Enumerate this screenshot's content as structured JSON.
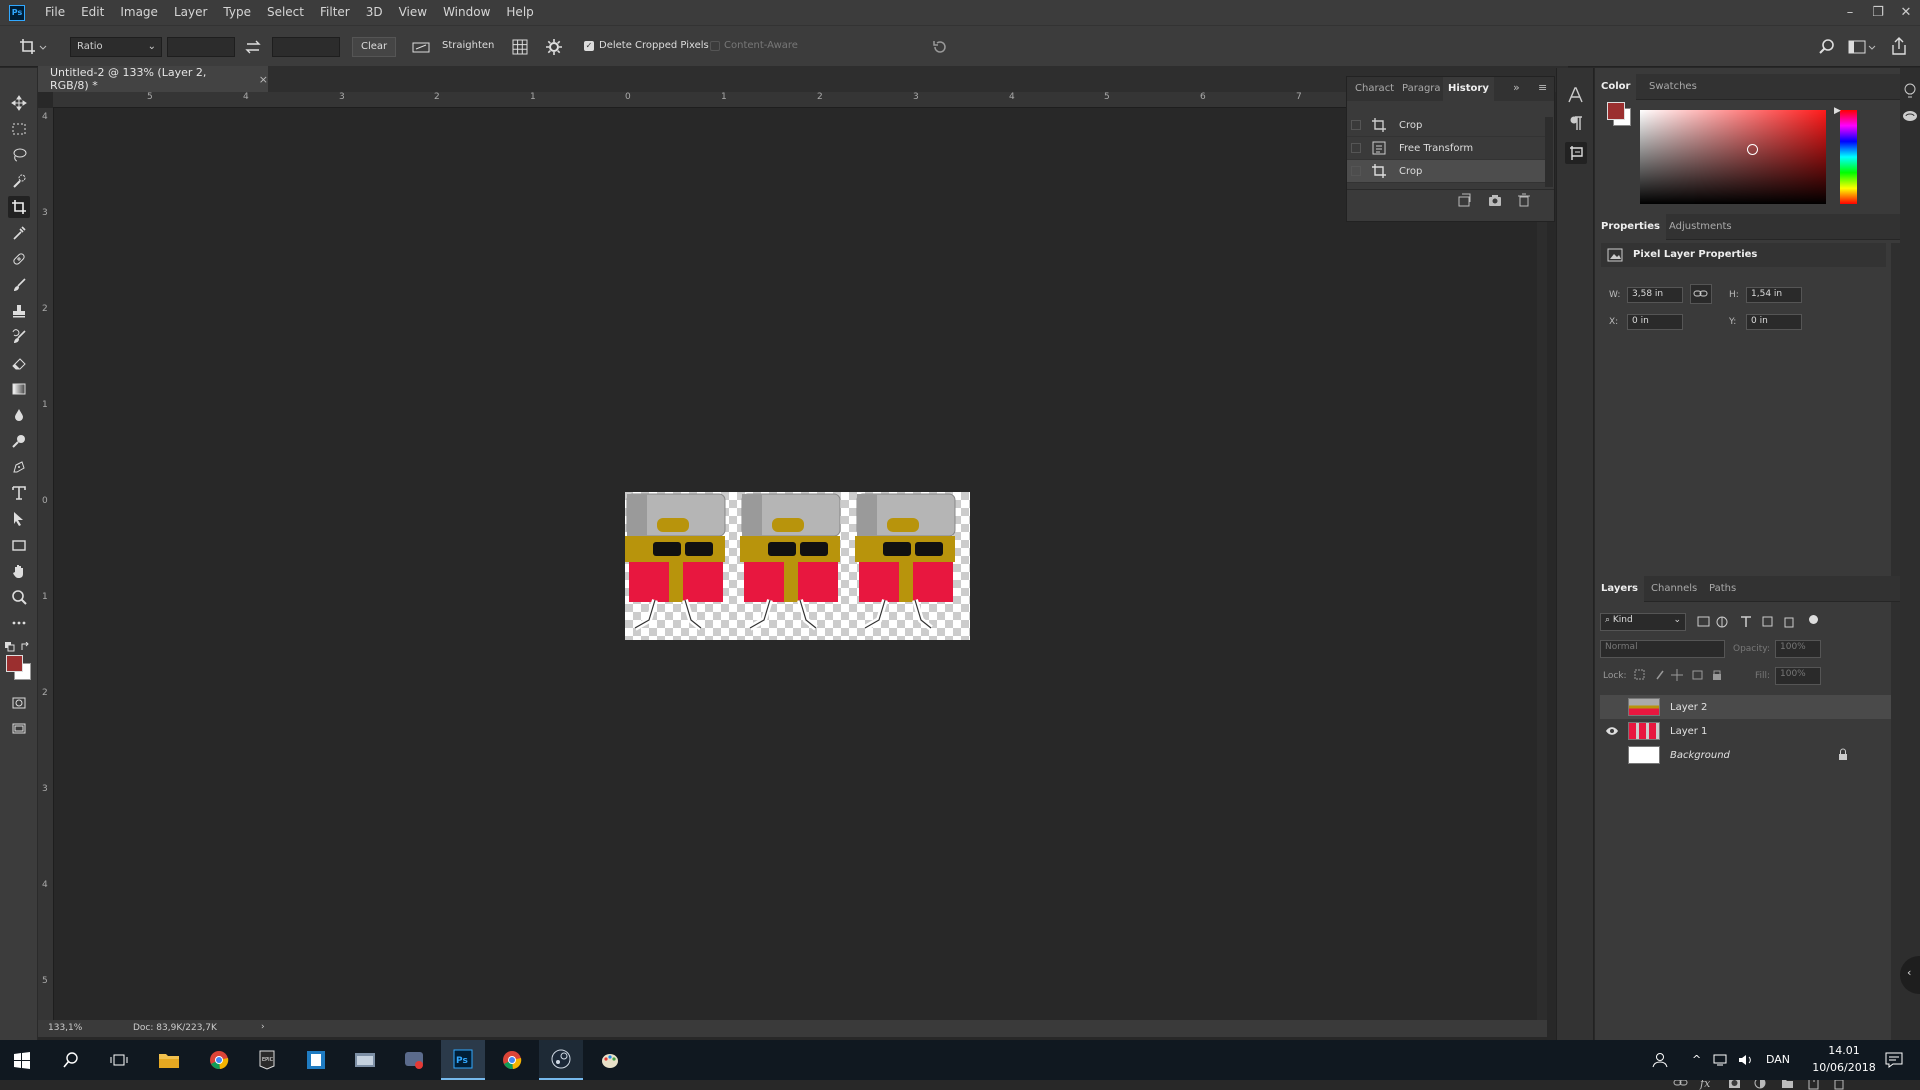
{
  "app": {
    "logo": "Ps"
  },
  "menu": [
    "File",
    "Edit",
    "Image",
    "Layer",
    "Type",
    "Select",
    "Filter",
    "3D",
    "View",
    "Window",
    "Help"
  ],
  "options": {
    "ratio_value": "Ratio",
    "clear_label": "Clear",
    "straighten_label": "Straighten",
    "delete_cropped_label": "Delete Cropped Pixels",
    "delete_cropped_checked": true,
    "content_aware_label": "Content-Aware"
  },
  "document": {
    "tab_title": "Untitled-2 @ 133% (Layer 2, RGB/8) *",
    "close": "×"
  },
  "rulers": {
    "h": [
      "5",
      "4",
      "3",
      "2",
      "1",
      "0",
      "1",
      "2",
      "3",
      "4",
      "5",
      "6",
      "7"
    ],
    "v": [
      "4",
      "3",
      "2",
      "1",
      "0",
      "1",
      "2",
      "3",
      "4",
      "5"
    ]
  },
  "status": {
    "zoom": "133,1%",
    "doc": "Doc: 83,9K/223,7K"
  },
  "history": {
    "tabs": [
      "Charact",
      "Paragra",
      "History"
    ],
    "items": [
      {
        "label": "Crop",
        "icon": "crop-icon"
      },
      {
        "label": "Free Transform",
        "icon": "transform-icon"
      },
      {
        "label": "Crop",
        "icon": "crop-icon",
        "selected": true
      }
    ]
  },
  "color_panel": {
    "tabs": [
      "Color",
      "Swatches"
    ],
    "foreground": "#9b2f2f",
    "background": "#ffffff"
  },
  "properties": {
    "tabs": [
      "Properties",
      "Adjustments"
    ],
    "title": "Pixel Layer Properties",
    "w_label": "W:",
    "w": "3,58 in",
    "h_label": "H:",
    "h": "1,54 in",
    "x_label": "X:",
    "x": "0 in",
    "y_label": "Y:",
    "y": "0 in"
  },
  "layers": {
    "tabs": [
      "Layers",
      "Channels",
      "Paths"
    ],
    "filter": "Kind",
    "blend": "Normal",
    "opacity_label": "Opacity:",
    "opacity": "100%",
    "lock_label": "Lock:",
    "fill_label": "Fill:",
    "fill": "100%",
    "items": [
      {
        "name": "Layer 2",
        "visible": false,
        "selected": true
      },
      {
        "name": "Layer 1",
        "visible": true,
        "selected": false
      },
      {
        "name": "Background",
        "visible": false,
        "locked": true,
        "italic": true
      }
    ]
  },
  "taskbar": {
    "lang": "DAN",
    "time": "14.01",
    "date": "10/06/2018"
  },
  "colors": {
    "accent": "#31a8ff",
    "panel": "#3a3a3a",
    "canvas": "#282828",
    "sprite_red": "#e8173f",
    "sprite_gold": "#b8940c"
  }
}
